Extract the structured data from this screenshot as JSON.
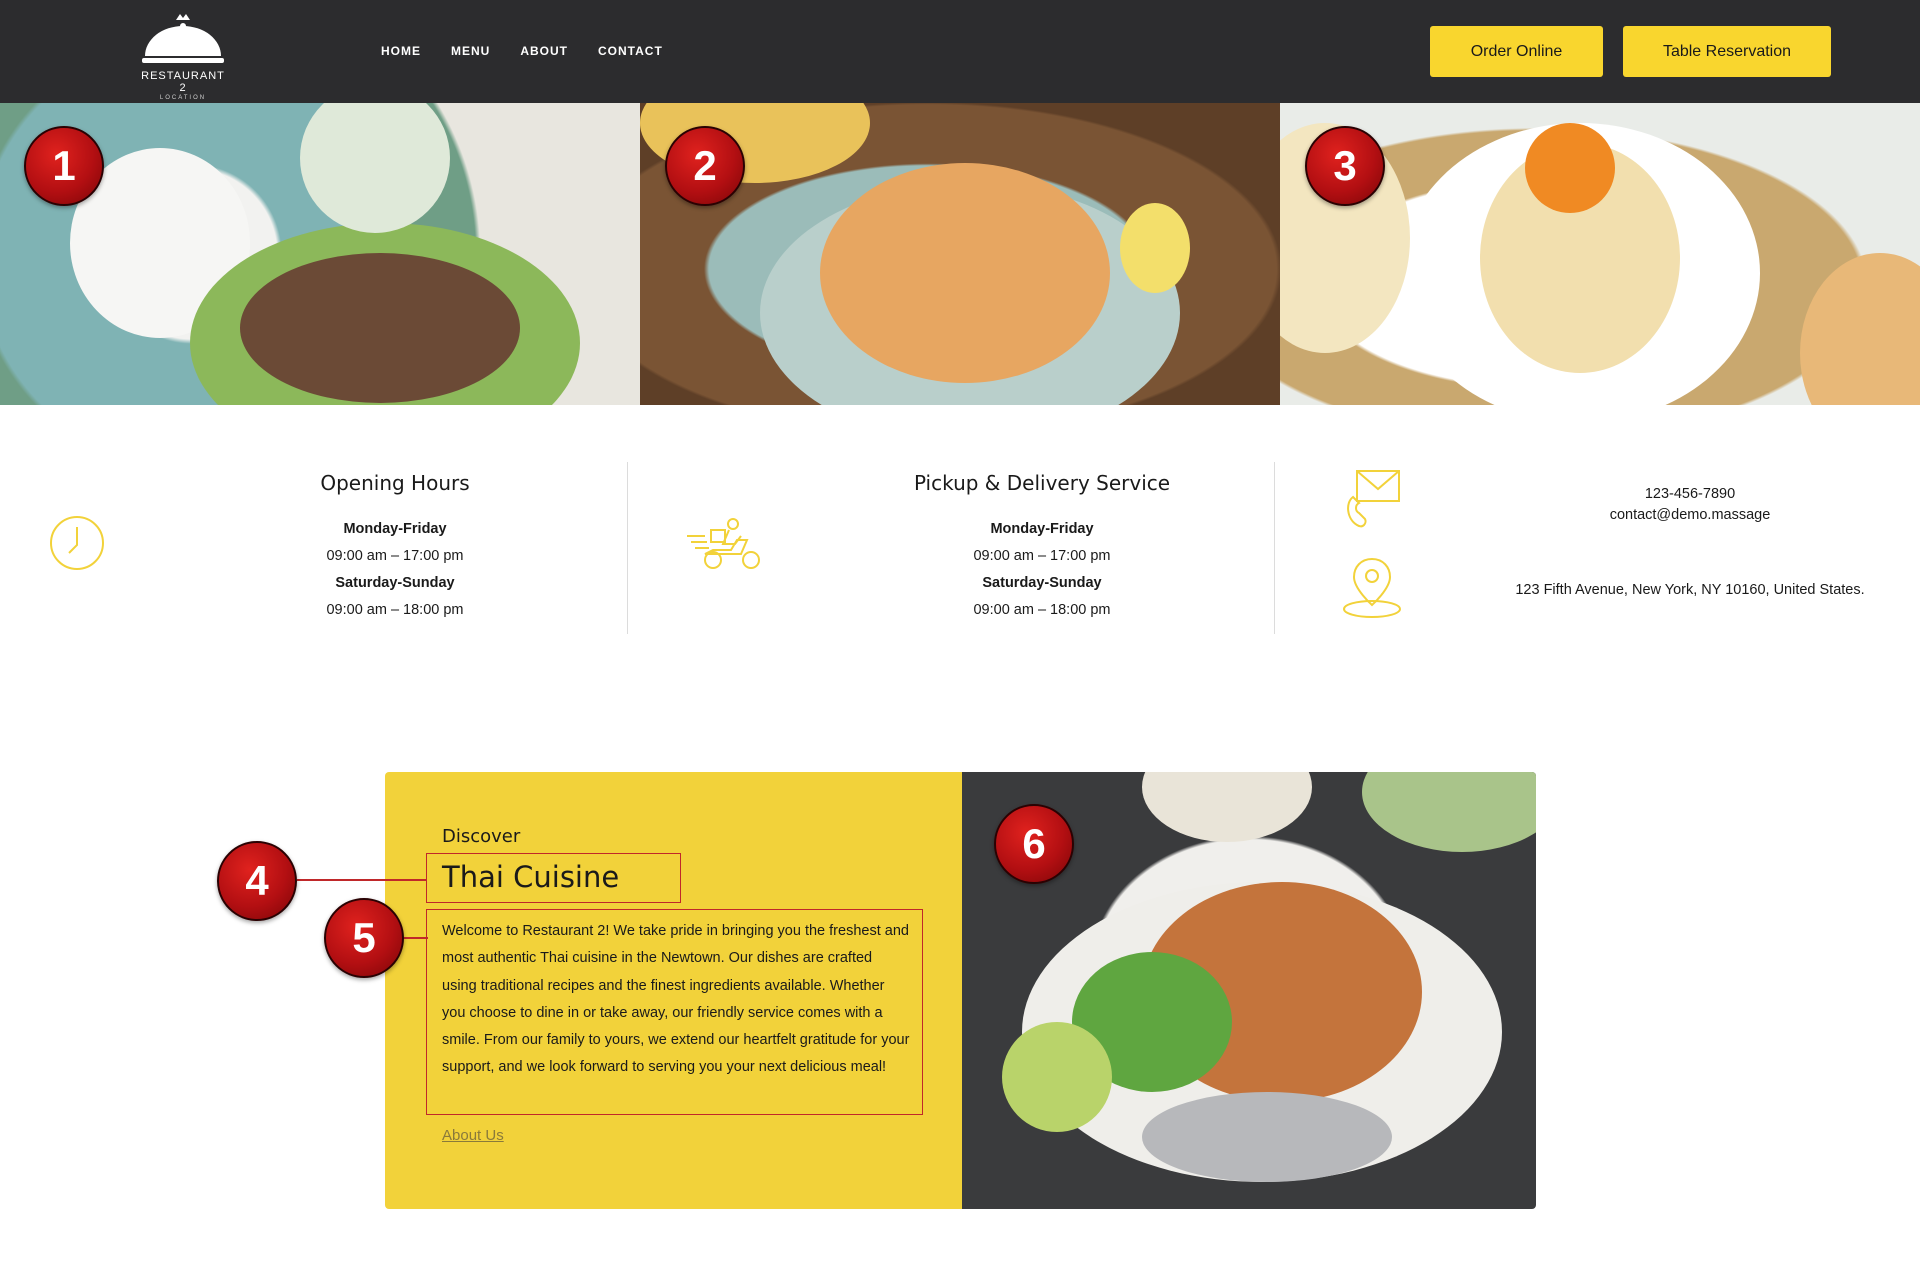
{
  "header": {
    "logo_name": "RESTAURANT 2",
    "logo_tag": "LOCATION",
    "nav": [
      "HOME",
      "MENU",
      "ABOUT",
      "CONTACT"
    ],
    "order_label": "Order Online",
    "reserve_label": "Table Reservation"
  },
  "markers": [
    "1",
    "2",
    "3",
    "4",
    "5",
    "6"
  ],
  "opening": {
    "title": "Opening Hours",
    "lines": [
      "Monday-Friday",
      "09:00 am – 17:00 pm",
      "Saturday-Sunday",
      "09:00 am – 18:00 pm"
    ]
  },
  "delivery": {
    "title": "Pickup & Delivery Service",
    "lines": [
      "Monday-Friday",
      "09:00 am – 17:00 pm",
      "Saturday-Sunday",
      "09:00 am – 18:00 pm"
    ]
  },
  "contact": {
    "phone": "123-456-7890",
    "email": "contact@demo.massage",
    "address": "123 Fifth Avenue, New York, NY 10160, United States."
  },
  "discover": {
    "label": "Discover",
    "title": "Thai Cuisine",
    "text": "Welcome to Restaurant 2! We take pride in bringing you the freshest and most authentic Thai cuisine in the Newtown. Our dishes are crafted using traditional recipes and the finest ingredients available. Whether you choose to dine in or take away, our friendly service comes with a smile. From our family to yours, we extend our heartfelt gratitude for your support, and we look forward to serving you your next delicious meal!",
    "link": "About Us"
  },
  "colors": {
    "header_bg": "#2c2c2e",
    "accent_yellow": "#f9d62e",
    "card_yellow": "#f2d23a",
    "marker_red": "#c0282a"
  }
}
